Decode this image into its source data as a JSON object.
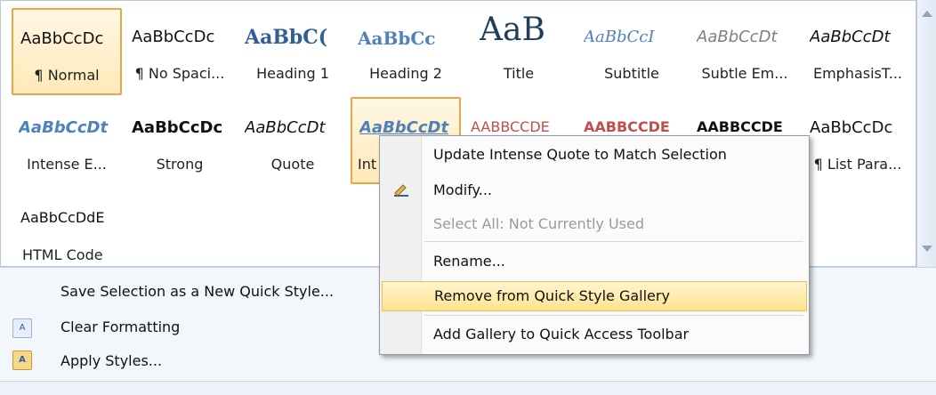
{
  "styles": [
    {
      "sample": "AaBbCcDc",
      "label": "¶ Normal"
    },
    {
      "sample": "AaBbCcDc",
      "label": "¶ No Spaci..."
    },
    {
      "sample": "AaBbC(",
      "label": "Heading 1"
    },
    {
      "sample": "AaBbCc",
      "label": "Heading 2"
    },
    {
      "sample": "AaB",
      "label": "Title"
    },
    {
      "sample": "AaBbCcI",
      "label": "Subtitle"
    },
    {
      "sample": "AaBbCcDt",
      "label": "Subtle Em..."
    },
    {
      "sample": "AaBbCcDt",
      "label": "EmphasisT..."
    },
    {
      "sample": "AaBbCcDt",
      "label": "Intense E..."
    },
    {
      "sample": "AaBbCcDc",
      "label": "Strong"
    },
    {
      "sample": "AaBbCcDt",
      "label": "Quote"
    },
    {
      "sample": "AaBbCcDt",
      "label": "Int"
    },
    {
      "sample": "AABBCCDE",
      "label": ""
    },
    {
      "sample": "AABBCCDE",
      "label": ""
    },
    {
      "sample": "AABBCCDE",
      "label": ""
    },
    {
      "sample": "AaBbCcDc",
      "label": "¶ List Para..."
    },
    {
      "sample": "AaBbCcDdE",
      "label": "HTML Code"
    }
  ],
  "commands": {
    "save_quick_style": "Save Selection as a New Quick Style...",
    "clear_formatting": "Clear Formatting",
    "apply_styles": "Apply Styles..."
  },
  "context_menu": {
    "update": "Update Intense Quote to Match Selection",
    "modify": "Modify...",
    "select_all": "Select All: Not Currently Used",
    "rename": "Rename...",
    "remove": "Remove from Quick Style Gallery",
    "add_gallery": "Add Gallery to Quick Access Toolbar"
  },
  "colors": {
    "selected_border": "#e7a64b",
    "menu_highlight": "#ffe38d",
    "heading_blue": "#2f5f95"
  }
}
